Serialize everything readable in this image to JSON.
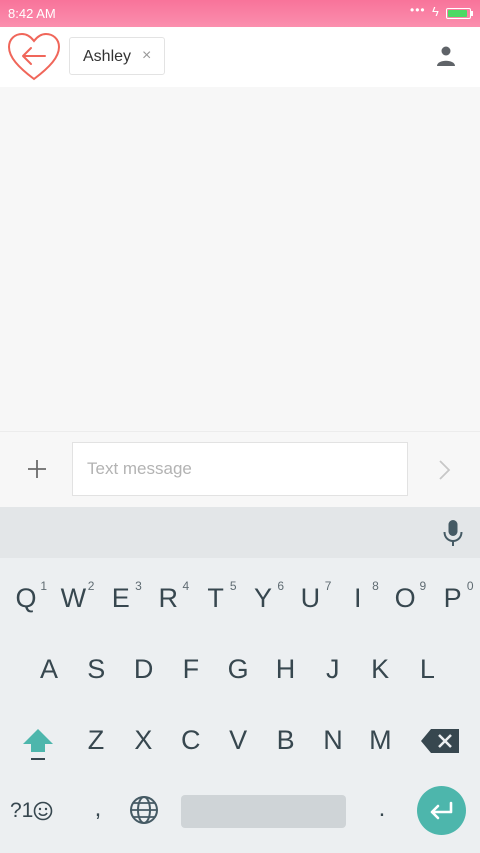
{
  "status_bar": {
    "time": "8:42 AM",
    "dots": "•••",
    "bolt": "ϟ",
    "battery_level": 0.95,
    "background": "#f8739a",
    "battery_color": "#4cd964"
  },
  "header": {
    "back_icon": "heart-back-arrow-icon",
    "back_icon_color": "#f0665a",
    "recipient": {
      "name": "Ashley",
      "remove_glyph": "×"
    },
    "contact_icon": "person-icon"
  },
  "compose": {
    "attach_icon": "plus-icon",
    "input_placeholder": "Text message",
    "input_value": "",
    "send_icon": "chevron-right-icon"
  },
  "keyboard": {
    "toolbar_icon": "microphone-icon",
    "row1": [
      {
        "char": "Q",
        "num": "1"
      },
      {
        "char": "W",
        "num": "2"
      },
      {
        "char": "E",
        "num": "3"
      },
      {
        "char": "R",
        "num": "4"
      },
      {
        "char": "T",
        "num": "5"
      },
      {
        "char": "Y",
        "num": "6"
      },
      {
        "char": "U",
        "num": "7"
      },
      {
        "char": "I",
        "num": "8"
      },
      {
        "char": "O",
        "num": "9"
      },
      {
        "char": "P",
        "num": "0"
      }
    ],
    "row2": [
      "A",
      "S",
      "D",
      "F",
      "G",
      "H",
      "J",
      "K",
      "L"
    ],
    "row3": [
      "Z",
      "X",
      "C",
      "V",
      "B",
      "N",
      "M"
    ],
    "shift_icon": "shift-arrow-icon",
    "backspace_icon": "backspace-icon",
    "symbols_label": "?1",
    "emoji_icon": "smiley-icon",
    "comma": ",",
    "globe_icon": "globe-icon",
    "period": ".",
    "enter_icon": "enter-icon",
    "accent": "#4db6ac"
  }
}
